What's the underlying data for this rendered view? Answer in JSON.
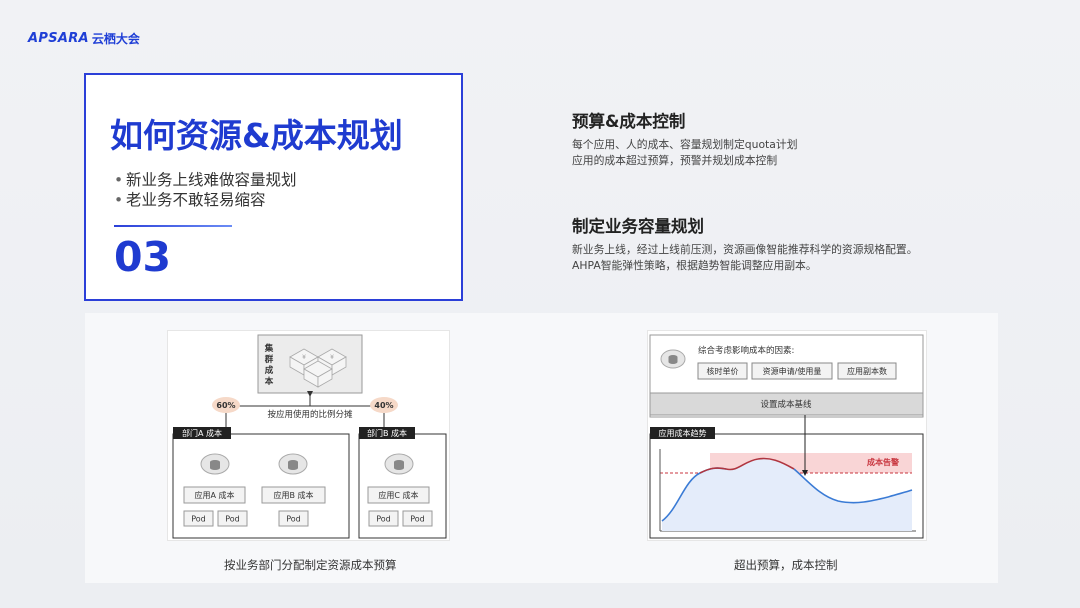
{
  "logo": {
    "latin": "APSARA",
    "cn": "云栖大会"
  },
  "title_card": {
    "heading": "如何资源&成本规划",
    "bullets": [
      "新业务上线难做容量规划",
      "老业务不敢轻易缩容"
    ],
    "number": "03"
  },
  "points": [
    {
      "title": "预算&成本控制",
      "lines": [
        "每个应用、人的成本、容量规划制定quota计划",
        "应用的成本超过预算，预警并规划成本控制"
      ]
    },
    {
      "title": "制定业务容量规划",
      "lines": [
        "新业务上线，经过上线前压测，资源画像智能推荐科学的资源规格配置。",
        "AHPA智能弹性策略，根据趋势智能调整应用副本。"
      ]
    }
  ],
  "left_diagram": {
    "cluster_label": [
      "集",
      "群",
      "成",
      "本"
    ],
    "split_label": "按应用使用的比例分摊",
    "pct_a": "60%",
    "pct_b": "40%",
    "dept_a": "部门A 成本",
    "dept_b": "部门B 成本",
    "app_a": "应用A 成本",
    "app_b": "应用B 成本",
    "app_c": "应用C 成本",
    "pod": "Pod",
    "caption": "按业务部门分配制定资源成本预算"
  },
  "right_diagram": {
    "factors_title": "综合考虑影响成本的因素:",
    "factors": [
      "核时单价",
      "资源申请/使用量",
      "应用副本数"
    ],
    "baseline": "设置成本基线",
    "trend_title": "应用成本趋势",
    "alert": "成本告警",
    "caption": "超出预算，成本控制"
  },
  "colors": {
    "accent": "#1f3bd0",
    "alert": "#c8363f",
    "trend_line": "#3a7bd5"
  }
}
